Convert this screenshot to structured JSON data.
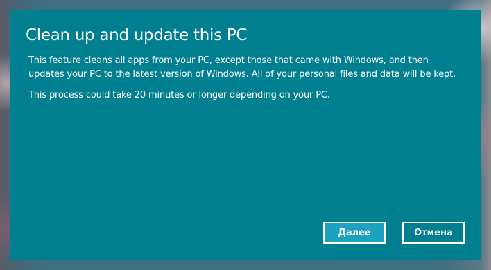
{
  "dialog": {
    "title": "Clean up and update this PC",
    "paragraphs": [
      "This feature cleans all apps from your PC, except those that came with Windows, and then updates your PC to the latest version of Windows. All of your personal files and data will be kept.",
      "This process could take 20 minutes or longer depending on your PC."
    ],
    "buttons": {
      "primary_label": "Далее",
      "secondary_label": "Отмена"
    }
  },
  "colors": {
    "dialog_background": "#007f91",
    "primary_button_background": "#1aa2bf",
    "text": "#ffffff"
  }
}
